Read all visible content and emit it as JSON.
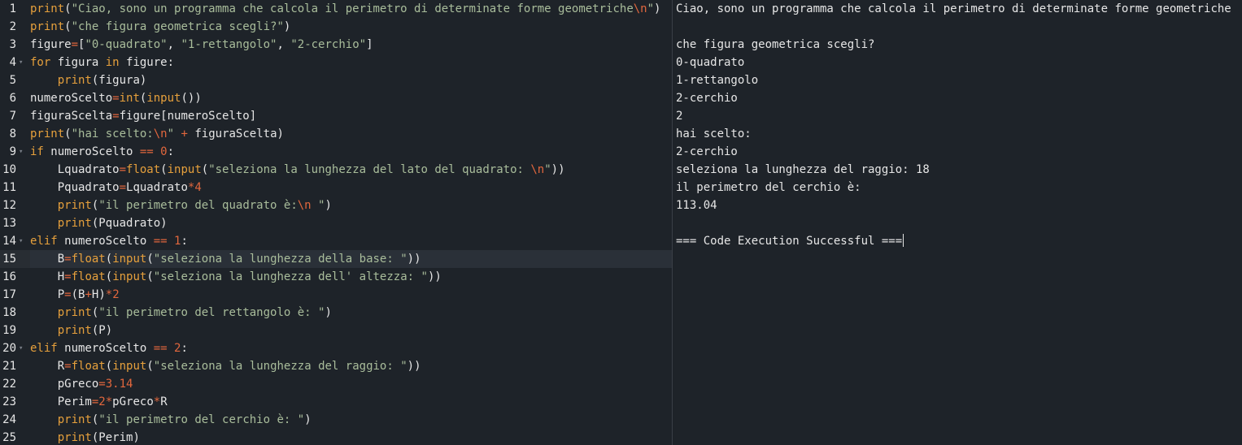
{
  "editor": {
    "active_line": 15,
    "lines": [
      {
        "num": "1",
        "fold": false,
        "tokens": [
          [
            "fn",
            "print"
          ],
          [
            "tx",
            "("
          ],
          [
            "str",
            "\"Ciao, sono un programma che calcola il perimetro di determinate forme geometriche"
          ],
          [
            "esc",
            "\\n"
          ],
          [
            "str",
            "\""
          ],
          [
            "tx",
            ")"
          ]
        ]
      },
      {
        "num": "2",
        "fold": false,
        "tokens": [
          [
            "fn",
            "print"
          ],
          [
            "tx",
            "("
          ],
          [
            "str",
            "\"che figura geometrica scegli?\""
          ],
          [
            "tx",
            ")"
          ]
        ]
      },
      {
        "num": "3",
        "fold": false,
        "tokens": [
          [
            "tx",
            "figure"
          ],
          [
            "op",
            "="
          ],
          [
            "tx",
            "["
          ],
          [
            "str",
            "\"0-quadrato\""
          ],
          [
            "tx",
            ", "
          ],
          [
            "str",
            "\"1-rettangolo\""
          ],
          [
            "tx",
            ", "
          ],
          [
            "str",
            "\"2-cerchio\""
          ],
          [
            "tx",
            "]"
          ]
        ]
      },
      {
        "num": "4",
        "fold": true,
        "tokens": [
          [
            "kw",
            "for"
          ],
          [
            "tx",
            " figura "
          ],
          [
            "kw",
            "in"
          ],
          [
            "tx",
            " figure:"
          ]
        ]
      },
      {
        "num": "5",
        "fold": false,
        "tokens": [
          [
            "tx",
            "    "
          ],
          [
            "fn",
            "print"
          ],
          [
            "tx",
            "(figura)"
          ]
        ]
      },
      {
        "num": "6",
        "fold": false,
        "tokens": [
          [
            "tx",
            "numeroScelto"
          ],
          [
            "op",
            "="
          ],
          [
            "fn",
            "int"
          ],
          [
            "tx",
            "("
          ],
          [
            "fn",
            "input"
          ],
          [
            "tx",
            "())"
          ]
        ]
      },
      {
        "num": "7",
        "fold": false,
        "tokens": [
          [
            "tx",
            "figuraScelta"
          ],
          [
            "op",
            "="
          ],
          [
            "tx",
            "figure[numeroScelto]"
          ]
        ]
      },
      {
        "num": "8",
        "fold": false,
        "tokens": [
          [
            "fn",
            "print"
          ],
          [
            "tx",
            "("
          ],
          [
            "str",
            "\"hai scelto:"
          ],
          [
            "esc",
            "\\n"
          ],
          [
            "str",
            "\""
          ],
          [
            "tx",
            " "
          ],
          [
            "op",
            "+"
          ],
          [
            "tx",
            " figuraScelta)"
          ]
        ]
      },
      {
        "num": "9",
        "fold": true,
        "tokens": [
          [
            "kw",
            "if"
          ],
          [
            "tx",
            " numeroScelto "
          ],
          [
            "op",
            "=="
          ],
          [
            "tx",
            " "
          ],
          [
            "num",
            "0"
          ],
          [
            "tx",
            ":"
          ]
        ]
      },
      {
        "num": "10",
        "fold": false,
        "tokens": [
          [
            "tx",
            "    Lquadrato"
          ],
          [
            "op",
            "="
          ],
          [
            "fn",
            "float"
          ],
          [
            "tx",
            "("
          ],
          [
            "fn",
            "input"
          ],
          [
            "tx",
            "("
          ],
          [
            "str",
            "\"seleziona la lunghezza del lato del quadrato: "
          ],
          [
            "esc",
            "\\n"
          ],
          [
            "str",
            "\""
          ],
          [
            "tx",
            "))"
          ]
        ]
      },
      {
        "num": "11",
        "fold": false,
        "tokens": [
          [
            "tx",
            "    Pquadrato"
          ],
          [
            "op",
            "="
          ],
          [
            "tx",
            "Lquadrato"
          ],
          [
            "op",
            "*"
          ],
          [
            "num",
            "4"
          ]
        ]
      },
      {
        "num": "12",
        "fold": false,
        "tokens": [
          [
            "tx",
            "    "
          ],
          [
            "fn",
            "print"
          ],
          [
            "tx",
            "("
          ],
          [
            "str",
            "\"il perimetro del quadrato è:"
          ],
          [
            "esc",
            "\\n"
          ],
          [
            "str",
            " \""
          ],
          [
            "tx",
            ")"
          ]
        ]
      },
      {
        "num": "13",
        "fold": false,
        "tokens": [
          [
            "tx",
            "    "
          ],
          [
            "fn",
            "print"
          ],
          [
            "tx",
            "(Pquadrato)"
          ]
        ]
      },
      {
        "num": "14",
        "fold": true,
        "tokens": [
          [
            "kw",
            "elif"
          ],
          [
            "tx",
            " numeroScelto "
          ],
          [
            "op",
            "=="
          ],
          [
            "tx",
            " "
          ],
          [
            "num",
            "1"
          ],
          [
            "tx",
            ":"
          ]
        ]
      },
      {
        "num": "15",
        "fold": false,
        "tokens": [
          [
            "tx",
            "    B"
          ],
          [
            "op",
            "="
          ],
          [
            "fn",
            "float"
          ],
          [
            "tx",
            "("
          ],
          [
            "fn",
            "input"
          ],
          [
            "tx",
            "("
          ],
          [
            "str",
            "\"seleziona la lunghezza della base: \""
          ],
          [
            "tx",
            "))"
          ]
        ]
      },
      {
        "num": "16",
        "fold": false,
        "tokens": [
          [
            "tx",
            "    H"
          ],
          [
            "op",
            "="
          ],
          [
            "fn",
            "float"
          ],
          [
            "tx",
            "("
          ],
          [
            "fn",
            "input"
          ],
          [
            "tx",
            "("
          ],
          [
            "str",
            "\"seleziona la lunghezza dell' altezza: \""
          ],
          [
            "tx",
            "))"
          ]
        ]
      },
      {
        "num": "17",
        "fold": false,
        "tokens": [
          [
            "tx",
            "    P"
          ],
          [
            "op",
            "="
          ],
          [
            "tx",
            "(B"
          ],
          [
            "op",
            "+"
          ],
          [
            "tx",
            "H)"
          ],
          [
            "op",
            "*"
          ],
          [
            "num",
            "2"
          ]
        ]
      },
      {
        "num": "18",
        "fold": false,
        "tokens": [
          [
            "tx",
            "    "
          ],
          [
            "fn",
            "print"
          ],
          [
            "tx",
            "("
          ],
          [
            "str",
            "\"il perimetro del rettangolo è: \""
          ],
          [
            "tx",
            ")"
          ]
        ]
      },
      {
        "num": "19",
        "fold": false,
        "tokens": [
          [
            "tx",
            "    "
          ],
          [
            "fn",
            "print"
          ],
          [
            "tx",
            "(P)"
          ]
        ]
      },
      {
        "num": "20",
        "fold": true,
        "tokens": [
          [
            "kw",
            "elif"
          ],
          [
            "tx",
            " numeroScelto "
          ],
          [
            "op",
            "=="
          ],
          [
            "tx",
            " "
          ],
          [
            "num",
            "2"
          ],
          [
            "tx",
            ":"
          ]
        ]
      },
      {
        "num": "21",
        "fold": false,
        "tokens": [
          [
            "tx",
            "    R"
          ],
          [
            "op",
            "="
          ],
          [
            "fn",
            "float"
          ],
          [
            "tx",
            "("
          ],
          [
            "fn",
            "input"
          ],
          [
            "tx",
            "("
          ],
          [
            "str",
            "\"seleziona la lunghezza del raggio: \""
          ],
          [
            "tx",
            "))"
          ]
        ]
      },
      {
        "num": "22",
        "fold": false,
        "tokens": [
          [
            "tx",
            "    pGreco"
          ],
          [
            "op",
            "="
          ],
          [
            "num",
            "3.14"
          ]
        ]
      },
      {
        "num": "23",
        "fold": false,
        "tokens": [
          [
            "tx",
            "    Perim"
          ],
          [
            "op",
            "="
          ],
          [
            "num",
            "2"
          ],
          [
            "op",
            "*"
          ],
          [
            "tx",
            "pGreco"
          ],
          [
            "op",
            "*"
          ],
          [
            "tx",
            "R"
          ]
        ]
      },
      {
        "num": "24",
        "fold": false,
        "tokens": [
          [
            "tx",
            "    "
          ],
          [
            "fn",
            "print"
          ],
          [
            "tx",
            "("
          ],
          [
            "str",
            "\"il perimetro del cerchio è: \""
          ],
          [
            "tx",
            ")"
          ]
        ]
      },
      {
        "num": "25",
        "fold": false,
        "tokens": [
          [
            "tx",
            "    "
          ],
          [
            "fn",
            "print"
          ],
          [
            "tx",
            "(Perim)"
          ]
        ]
      }
    ]
  },
  "console": {
    "lines": [
      "Ciao, sono un programma che calcola il perimetro di determinate forme geometriche",
      "",
      "che figura geometrica scegli?",
      "0-quadrato",
      "1-rettangolo",
      "2-cerchio",
      "2",
      "hai scelto:",
      "2-cerchio",
      "seleziona la lunghezza del raggio: 18",
      "il perimetro del cerchio è:",
      "113.04",
      "",
      "=== Code Execution Successful ==="
    ]
  },
  "icons": {
    "fold_marker": "chevron-down-icon"
  }
}
